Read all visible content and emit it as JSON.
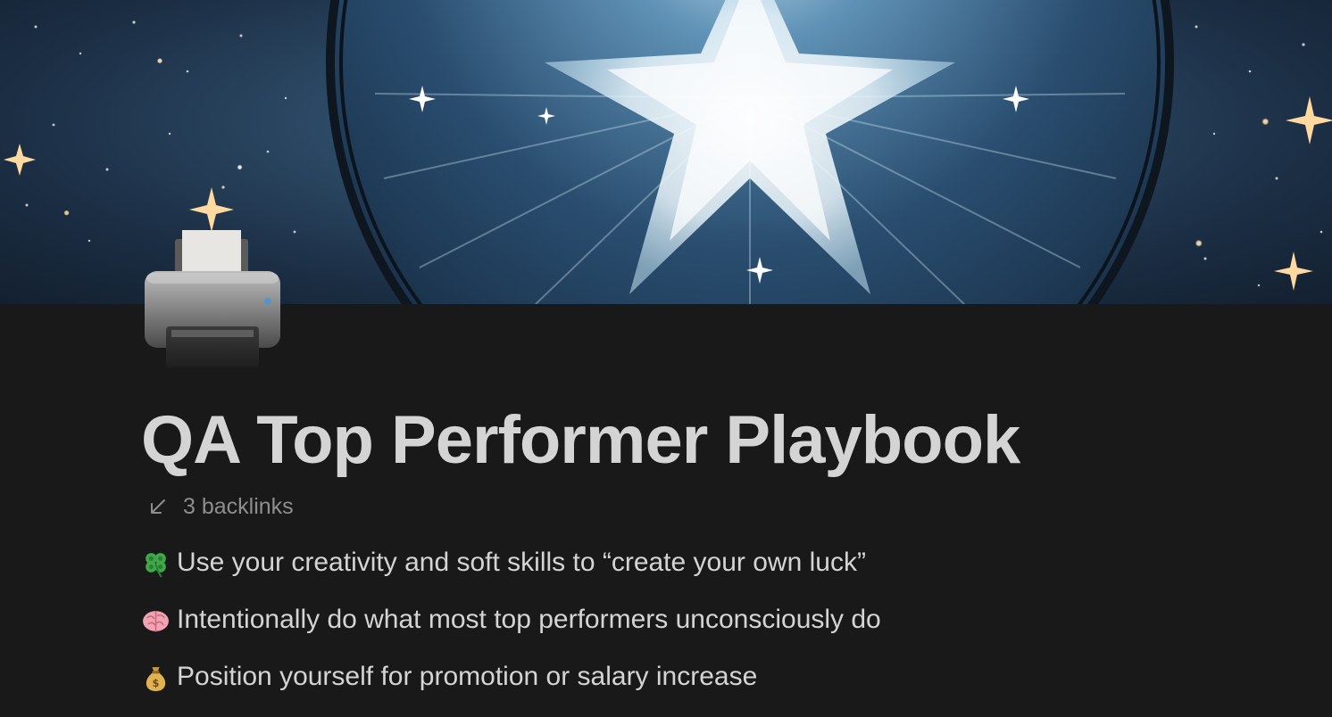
{
  "page": {
    "title": "QA Top Performer Playbook",
    "icon": "printer-icon",
    "cover": "starburst-cover-image"
  },
  "backlinks": {
    "icon": "arrow-down-left-icon",
    "label": "3 backlinks"
  },
  "bullets": [
    {
      "icon": "four-leaf-clover-icon",
      "text": "Use your creativity and soft skills to “create your own luck”"
    },
    {
      "icon": "brain-icon",
      "text": "Intentionally do what most top performers unconsciously do"
    },
    {
      "icon": "money-bag-icon",
      "text": "Position yourself for promotion or salary increase"
    }
  ],
  "colors": {
    "background": "#191919",
    "text": "#d4d4d4",
    "muted": "#8e8e8e"
  }
}
